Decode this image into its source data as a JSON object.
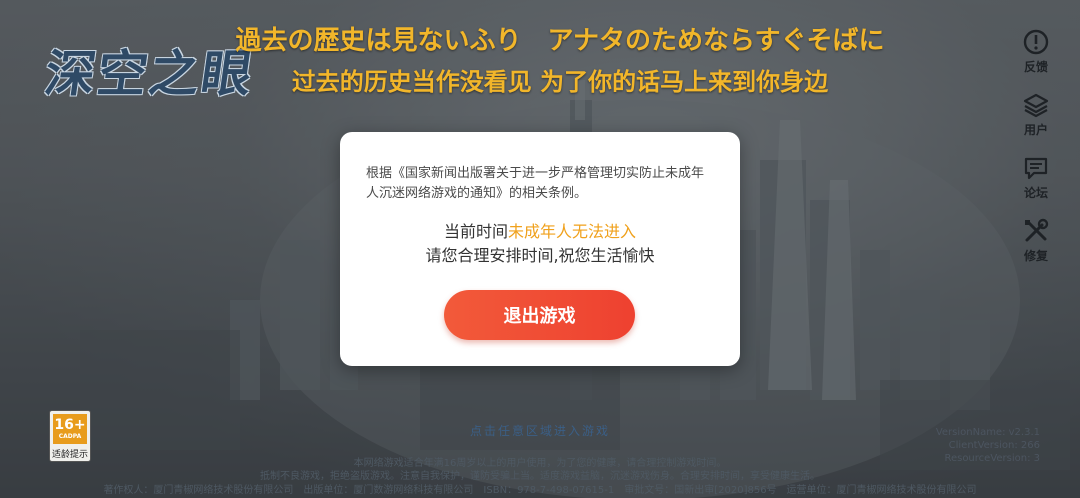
{
  "game": {
    "logo_text": "深空之眼"
  },
  "lyrics": {
    "japanese": "過去の歴史は見ないふり　アナタのためならすぐそばに",
    "chinese": "过去的历史当作没看见 为了你的话马上来到你身边"
  },
  "side_menu": [
    {
      "label": "反馈",
      "icon": "exclamation-circle-icon"
    },
    {
      "label": "用户",
      "icon": "layers-icon"
    },
    {
      "label": "论坛",
      "icon": "chat-bubble-icon"
    },
    {
      "label": "修复",
      "icon": "wrench-screwdriver-icon"
    }
  ],
  "age_rating": {
    "value": "16+",
    "org": "CADPA",
    "label": "适龄提示"
  },
  "tap_hint": "点击任意区域进入游戏",
  "notice": {
    "line1": "本网络游戏适合年满16周岁以上的用户使用，为了您的健康，请合理控制游戏时间。",
    "line2": "抵制不良游戏，拒绝盗版游戏。注意自我保护，谨防受骗上当。适度游戏益脑，沉迷游戏伤身。合理安排时间，享受健康生活。",
    "line3": "著作权人：厦门青椒网络技术股份有限公司　出版单位：厦门数游网络科技有限公司　ISBN：978-7-498-07615-1　审批文号：国新出审[2020]856号　运营单位：厦门青椒网络技术股份有限公司"
  },
  "version": {
    "version_name": "VersionName: v2.3.1",
    "client_version": "ClientVersion: 266",
    "resource_version": "ResourceVersion: 3"
  },
  "modal": {
    "legal_text": "根据《国家新闻出版署关于进一步严格管理切实防止未成年人沉迷网络游戏的通知》的相关条例。",
    "line1_prefix": "当前时间",
    "line1_highlight": "未成年人无法进入",
    "line2": "请您合理安排时间,祝您生活愉快",
    "exit_button": "退出游戏"
  },
  "colors": {
    "lyric": "#f2b62a",
    "highlight": "#f0a11c",
    "button": "#ee4130",
    "age_badge": "#e89c1c"
  }
}
